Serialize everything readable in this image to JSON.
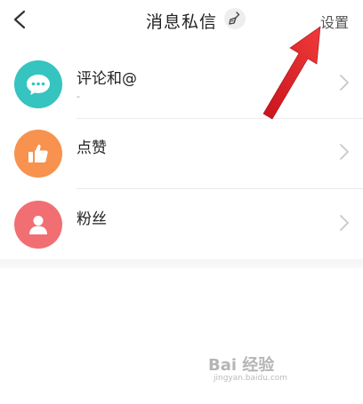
{
  "header": {
    "title": "消息私信",
    "settings_label": "设置",
    "back_icon": "chevron-left-icon",
    "clean_icon": "broom-icon"
  },
  "items": [
    {
      "label": "评论和@",
      "subtitle": "-",
      "icon": "chat-bubble-icon",
      "color": "#35c4c0"
    },
    {
      "label": "点赞",
      "icon": "thumbs-up-icon",
      "color": "#f7924f"
    },
    {
      "label": "粉丝",
      "icon": "person-icon",
      "color": "#f16e72"
    }
  ],
  "annotation": {
    "arrow_color": "#e8232b"
  },
  "watermark": {
    "logo": "Bai 经验",
    "url": "jingyan.baidu.com"
  }
}
